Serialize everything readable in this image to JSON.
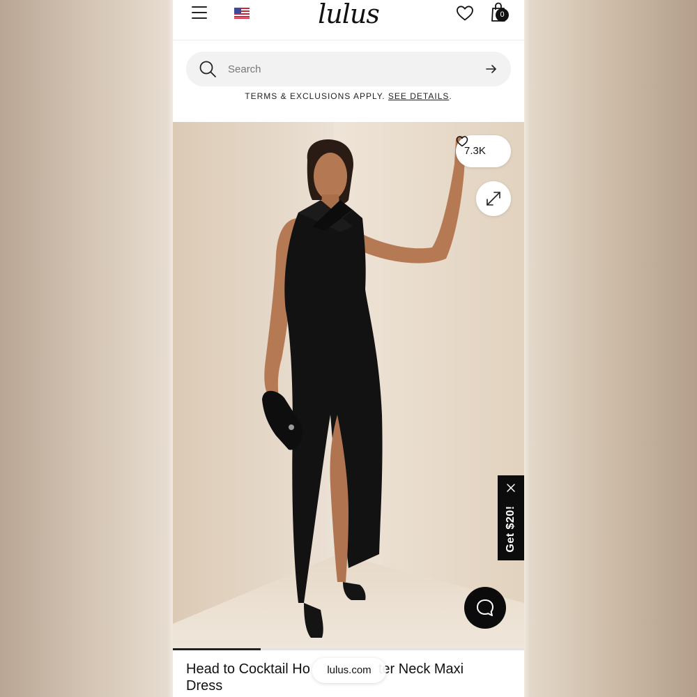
{
  "header": {
    "logo_text": "lulus",
    "menu_icon": "hamburger-menu-icon",
    "flag_icon": "us-flag-icon",
    "wishlist_icon": "heart-icon",
    "bag_icon": "shopping-bag-icon",
    "bag_count": "0"
  },
  "search": {
    "placeholder": "Search",
    "value": "",
    "icon": "search-icon",
    "submit_icon": "arrow-right-icon"
  },
  "promo": {
    "text": "TERMS & EXCLUSIONS APPLY.",
    "link_label": "SEE DETAILS",
    "suffix": "."
  },
  "product": {
    "likes_count": "7.3K",
    "likes_icon": "heart-outline-icon",
    "expand_icon": "expand-arrows-icon",
    "image_progress": 0.25,
    "title": "Head to Cocktail Ho... ter Neck Maxi Dress",
    "title_visible_start": "Head to Cocktail Ho",
    "title_visible_end": "ter Neck Maxi Dress"
  },
  "offer": {
    "label": "Get $20!",
    "close_icon": "close-icon"
  },
  "chat": {
    "icon": "chat-bubble-icon"
  },
  "browser": {
    "url": "lulus.com"
  },
  "colors": {
    "brand": "#111111",
    "offer_bg": "#0c0c0c",
    "search_bg": "#f2f2f2",
    "dress": "#121212",
    "skin": "#b57a54",
    "wall": "#e8ddd0"
  }
}
